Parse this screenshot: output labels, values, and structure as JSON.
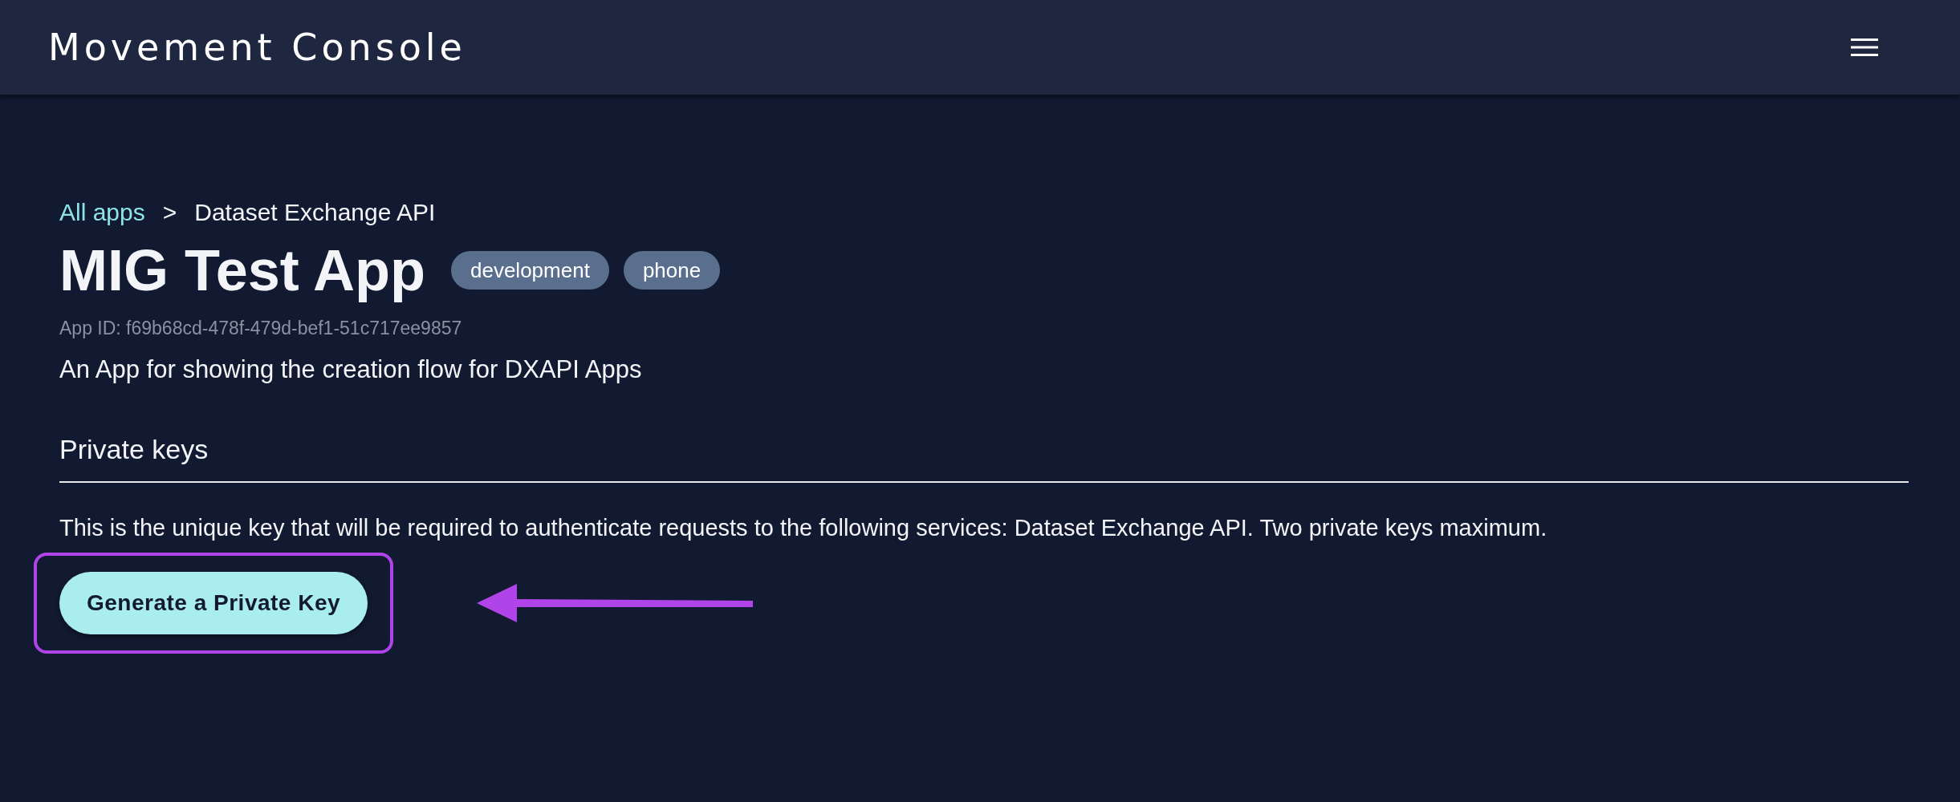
{
  "header": {
    "title": "Movement Console"
  },
  "breadcrumb": {
    "link": "All apps",
    "separator": ">",
    "current": "Dataset Exchange API"
  },
  "app": {
    "title": "MIG Test App",
    "tags": [
      "development",
      "phone"
    ],
    "app_id": "App ID: f69b68cd-478f-479d-bef1-51c717ee9857",
    "description": "An App for showing the creation flow for DXAPI Apps"
  },
  "private_keys": {
    "heading": "Private keys",
    "text": "This is the unique key that will be required to authenticate requests to the following services: Dataset Exchange API. Two private keys maximum.",
    "button": "Generate a Private Key"
  }
}
